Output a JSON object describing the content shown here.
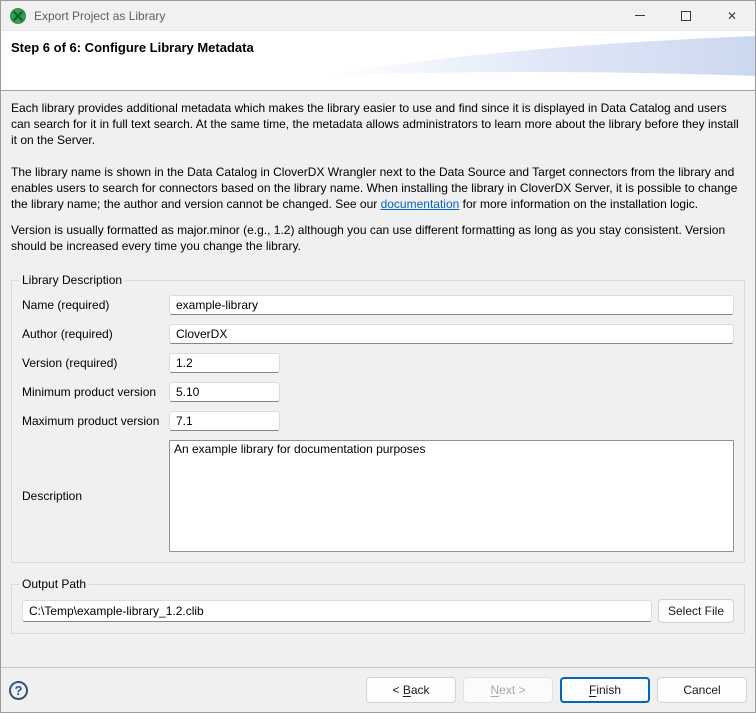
{
  "window": {
    "title": "Export Project as Library",
    "icons": {
      "close": "✕",
      "help": "?"
    }
  },
  "header": {
    "title": "Step 6 of 6: Configure Library Metadata"
  },
  "intro": {
    "para1": "Each library provides additional metadata which makes the library easier to use and find since it is displayed in Data Catalog and users can search for it in full text search. At the same time, the metadata allows administrators to learn more about the library before they install it on the Server.",
    "para2_before": "The library name is shown in the Data Catalog in CloverDX Wrangler next to the Data Source and Target connectors from the library and enables users to search for connectors based on the library name. When installing the library in CloverDX Server, it is possible to change the library name; the author and version cannot be changed. See our ",
    "para2_link": "documentation",
    "para2_after": " for more information on the installation logic.",
    "para3": "Version is usually formatted as major.minor (e.g., 1.2) although you can use different formatting as long as you stay consistent. Version should be increased every time you change the library."
  },
  "library_description": {
    "legend": "Library Description",
    "fields": {
      "name": {
        "label": "Name (required)",
        "value": "example-library"
      },
      "author": {
        "label": "Author (required)",
        "value": "CloverDX"
      },
      "version": {
        "label": "Version (required)",
        "value": "1.2"
      },
      "min_product_version": {
        "label": "Minimum product version",
        "value": "5.10"
      },
      "max_product_version": {
        "label": "Maximum product version",
        "value": "7.1"
      },
      "description": {
        "label": "Description",
        "value": "An example library for documentation purposes"
      }
    }
  },
  "output_path": {
    "legend": "Output Path",
    "value": "C:\\Temp\\example-library_1.2.clib",
    "select_file_label": "Select File"
  },
  "footer": {
    "back": {
      "prefix": "< ",
      "key": "B",
      "rest": "ack"
    },
    "next": {
      "key": "N",
      "rest": "ext >"
    },
    "finish": {
      "key": "F",
      "rest": "inish"
    },
    "cancel_label": "Cancel"
  },
  "colors": {
    "accent": "#0067c0",
    "link": "#0563c1",
    "clover_green": "#2da44e"
  }
}
